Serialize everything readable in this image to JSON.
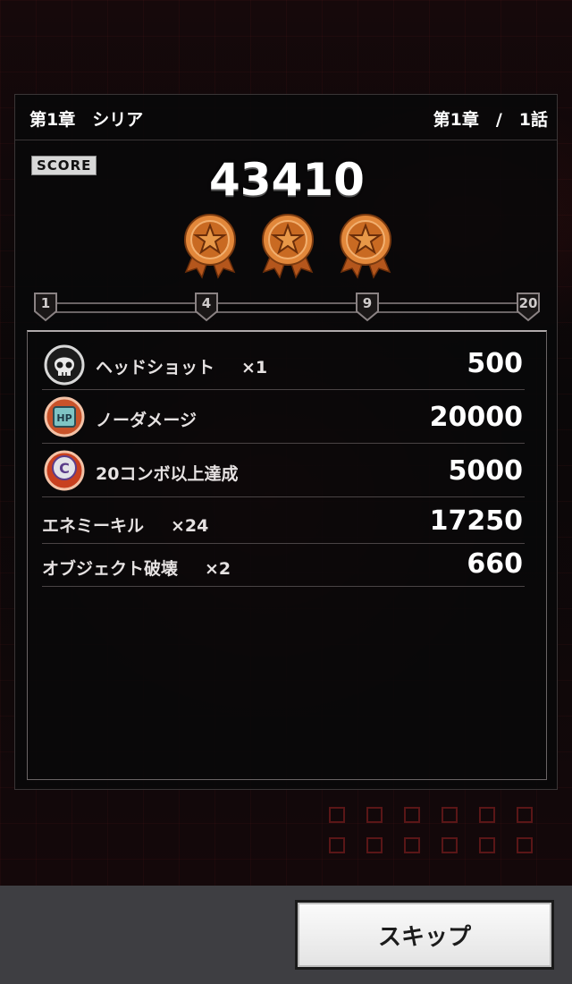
{
  "header": {
    "chapter_title": "第1章　シリア",
    "progress": "第1章　/　1話"
  },
  "score": {
    "label": "SCORE",
    "value": "43410"
  },
  "medals": [
    {
      "icon": "bronze-star-medal"
    },
    {
      "icon": "bronze-star-medal"
    },
    {
      "icon": "bronze-star-medal"
    }
  ],
  "milestones": [
    "1",
    "4",
    "9",
    "20"
  ],
  "bonuses": [
    {
      "icon": "skull-icon",
      "label": "ヘッドショット",
      "multiplier": "×1",
      "value": "500"
    },
    {
      "icon": "hp-icon",
      "label": "ノーダメージ",
      "multiplier": "",
      "value": "20000"
    },
    {
      "icon": "combo-c-icon",
      "label": "20コンボ以上達成",
      "multiplier": "",
      "value": "5000"
    },
    {
      "icon": "",
      "label": "エネミーキル",
      "multiplier": "×24",
      "value": "17250"
    },
    {
      "icon": "",
      "label": "オブジェクト破壊",
      "multiplier": "×2",
      "value": "660"
    }
  ],
  "footer": {
    "skip_label": "スキップ"
  },
  "colors": {
    "medal_bronze": "#d8762e",
    "accent_red": "#7a1a1a",
    "button_bg": "#f0f0f0"
  }
}
